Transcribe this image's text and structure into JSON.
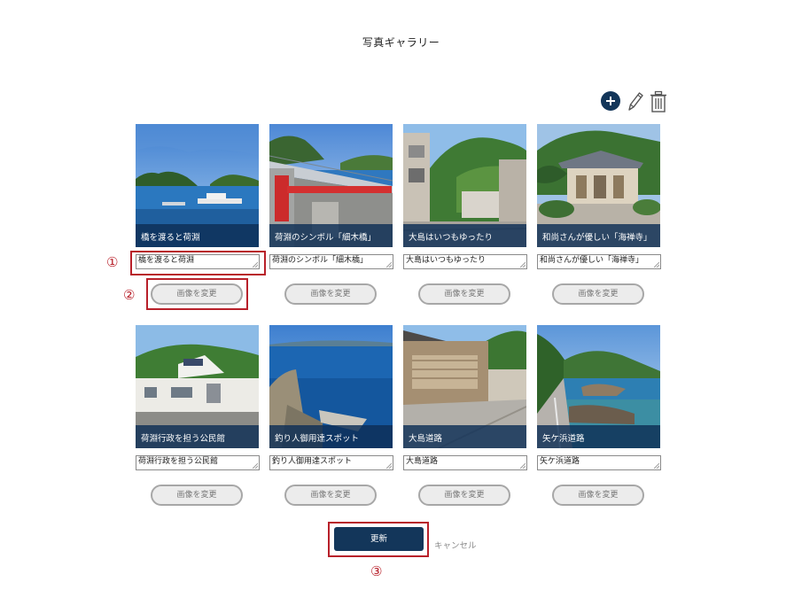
{
  "page": {
    "title": "写真ギャラリー"
  },
  "toolbar": {
    "add_icon": "plus-circle-icon",
    "edit_icon": "pencil-icon",
    "delete_icon": "trash-icon"
  },
  "gallery": {
    "items": [
      {
        "caption": "橋を渡ると荷淵",
        "input_value": "橋を渡ると荷淵",
        "change_label": "画像を変更"
      },
      {
        "caption": "荷淵のシンボル「細木橋」",
        "input_value": "荷淵のシンボル「細木橋」",
        "change_label": "画像を変更"
      },
      {
        "caption": "大島はいつもゆったり",
        "input_value": "大島はいつもゆったり",
        "change_label": "画像を変更"
      },
      {
        "caption": "和尚さんが優しい「海禅寺」",
        "input_value": "和尚さんが優しい「海禅寺」",
        "change_label": "画像を変更"
      },
      {
        "caption": "荷淵行政を担う公民館",
        "input_value": "荷淵行政を担う公民館",
        "change_label": "画像を変更"
      },
      {
        "caption": "釣り人御用達スポット",
        "input_value": "釣り人御用達スポット",
        "change_label": "画像を変更"
      },
      {
        "caption": "大島道路",
        "input_value": "大島道路",
        "change_label": "画像を変更"
      },
      {
        "caption": "矢ケ浜道路",
        "input_value": "矢ケ浜道路",
        "change_label": "画像を変更"
      }
    ]
  },
  "actions": {
    "update_label": "更新",
    "cancel_label": "キャンセル"
  },
  "annotations": {
    "mark1": "①",
    "mark2": "②",
    "mark3": "③"
  },
  "colors": {
    "accent": "#13365a",
    "annotation": "#b8202a"
  }
}
